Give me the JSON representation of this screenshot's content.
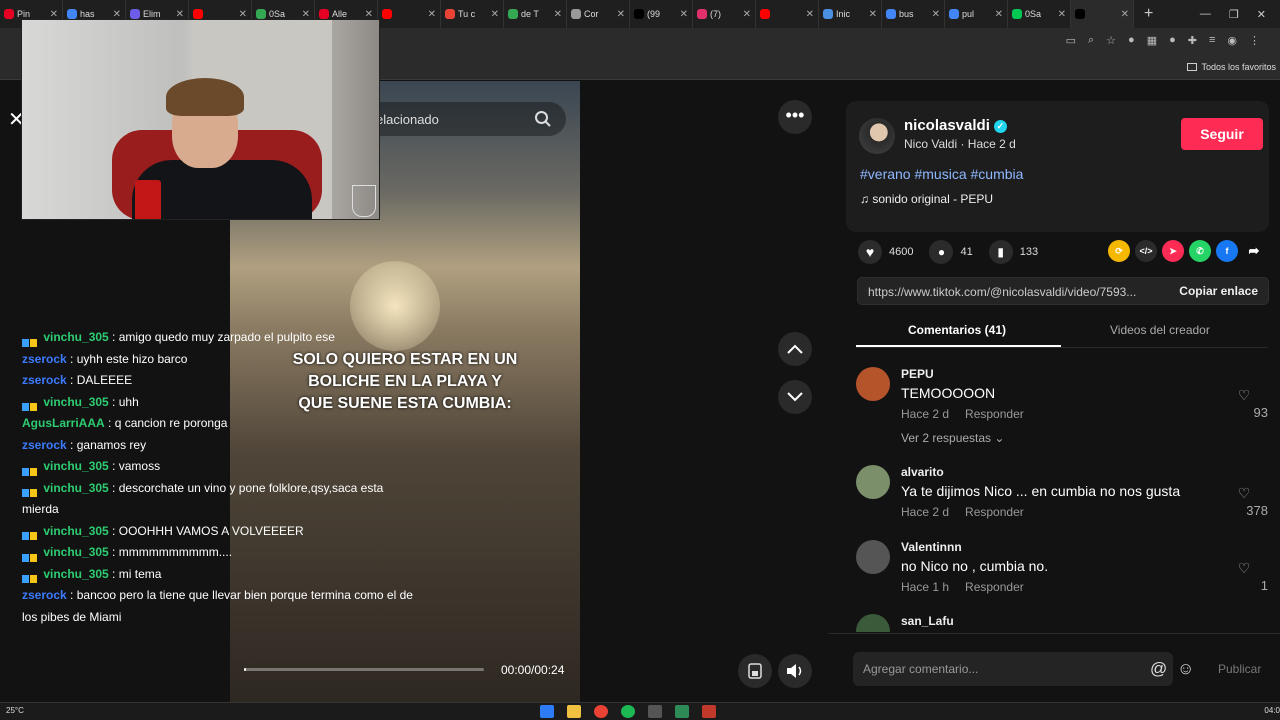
{
  "browser": {
    "tabs": [
      {
        "label": "Pin",
        "color": "#e60023"
      },
      {
        "label": "has",
        "color": "#4285f4"
      },
      {
        "label": "Elim",
        "color": "#6c5ce7"
      },
      {
        "label": "",
        "color": "#ff0000"
      },
      {
        "label": "0Sa",
        "color": "#34a853"
      },
      {
        "label": "Alle",
        "color": "#e60023"
      },
      {
        "label": "",
        "color": "#ff0000"
      },
      {
        "label": "Tu c",
        "color": "#ea4335"
      },
      {
        "label": "de T",
        "color": "#34a853"
      },
      {
        "label": "Cor",
        "color": "#999999"
      },
      {
        "label": "(99",
        "color": "#000000"
      },
      {
        "label": "(7)",
        "color": "#e1306c"
      },
      {
        "label": "",
        "color": "#ff0000"
      },
      {
        "label": "Inic",
        "color": "#4a90e2"
      },
      {
        "label": "bus",
        "color": "#4285f4"
      },
      {
        "label": "pul",
        "color": "#4285f4"
      },
      {
        "label": "0Sa",
        "color": "#00c853"
      },
      {
        "label": "",
        "color": "#000000"
      }
    ],
    "bookmarks_label": "Todos los favoritos"
  },
  "video": {
    "search_text": "elacionado",
    "caption": "SOLO QUIERO ESTAR EN UN BOLICHE EN LA PLAYA Y QUE SUENE ESTA CUMBIA:",
    "time": "00:00/00:24",
    "progress": 0.01
  },
  "chat": [
    {
      "user": "vinchu_305",
      "text": "amigo quedo muy zarpado el pulpito ese",
      "color": "#2ecc71",
      "badges": true
    },
    {
      "user": "zserock",
      "text": "uyhh este hizo barco",
      "color": "#3c7bff",
      "badges": false
    },
    {
      "user": "zserock",
      "text": "DALEEEE",
      "color": "#3c7bff",
      "badges": false
    },
    {
      "user": "vinchu_305",
      "text": "uhh",
      "color": "#2ecc71",
      "badges": true
    },
    {
      "user": "AgusLarriAAA",
      "text": "q cancion re poronga",
      "color": "#2ecc71",
      "badges": false
    },
    {
      "user": "zserock",
      "text": "ganamos rey",
      "color": "#3c7bff",
      "badges": false
    },
    {
      "user": "vinchu_305",
      "text": "vamoss",
      "color": "#2ecc71",
      "badges": true
    },
    {
      "user": "vinchu_305",
      "text": "descorchate un vino y pone folklore,qsy,saca esta mierda",
      "color": "#2ecc71",
      "badges": true
    },
    {
      "user": "vinchu_305",
      "text": "OOOHHH VAMOS A VOLVEEEER",
      "color": "#2ecc71",
      "badges": true
    },
    {
      "user": "vinchu_305",
      "text": "mmmmmmmmmm....",
      "color": "#2ecc71",
      "badges": true
    },
    {
      "user": "vinchu_305",
      "text": "mi tema",
      "color": "#2ecc71",
      "badges": true
    },
    {
      "user": "zserock",
      "text": "bancoo pero la tiene que llevar bien porque termina como el de los pibes de Miami",
      "color": "#3c7bff",
      "badges": false
    }
  ],
  "post": {
    "username": "nicolasvaldi",
    "subline": "Nico Valdi · Hace 2 d",
    "follow_label": "Seguir",
    "hashtags": "#verano #musica #cumbia",
    "sound": "sonido original - PEPU",
    "likes": "4600",
    "comments": "41",
    "saves": "133",
    "url": "https://www.tiktok.com/@nicolasvaldi/video/7593...",
    "copy_label": "Copiar enlace",
    "tab_comments": "Comentarios (41)",
    "tab_creator": "Videos del creador"
  },
  "comments": [
    {
      "name": "PEPU",
      "text": "TEMOOOOON",
      "time": "Hace 2 d",
      "reply": "Responder",
      "likes": "93",
      "more": "Ver 2 respuestas",
      "avatar_color": "#b5542a"
    },
    {
      "name": "alvarito",
      "text": "Ya te dijimos Nico ... en cumbia no nos gusta",
      "time": "Hace 2 d",
      "reply": "Responder",
      "likes": "378",
      "more": "",
      "avatar_color": "#7a8f6a"
    },
    {
      "name": "Valentinnn",
      "text": "no Nico no , cumbia no.",
      "time": "Hace 1 h",
      "reply": "Responder",
      "likes": "1",
      "more": "",
      "avatar_color": "#555555"
    },
    {
      "name": "san_Lafu",
      "text": "",
      "time": "",
      "reply": "",
      "likes": "",
      "more": "",
      "avatar_color": "#3a5a3a"
    }
  ],
  "comment_bar": {
    "placeholder": "Agregar comentario...",
    "publish_label": "Publicar"
  },
  "taskbar": {
    "weather": "25°C",
    "clock": "04:0"
  }
}
